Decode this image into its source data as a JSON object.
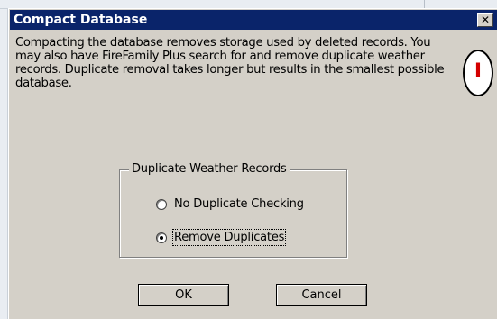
{
  "dialog": {
    "title": "Compact Database",
    "close_glyph": "✕",
    "description": "Compacting the database removes storage used by deleted records. You may also have FireFamily Plus search for and remove duplicate weather records. Duplicate removal takes longer but results in the smallest possible database.",
    "callout_label": "I",
    "callout_color": "#d40000"
  },
  "duplicate_group": {
    "legend": "Duplicate Weather Records",
    "options": [
      {
        "label": "No Duplicate Checking",
        "selected": false
      },
      {
        "label": "Remove Duplicates",
        "selected": true
      }
    ]
  },
  "buttons": {
    "ok": "OK",
    "cancel": "Cancel"
  },
  "colors": {
    "titlebar": "#0a246a",
    "dialog_bg": "#d4d0c8"
  }
}
